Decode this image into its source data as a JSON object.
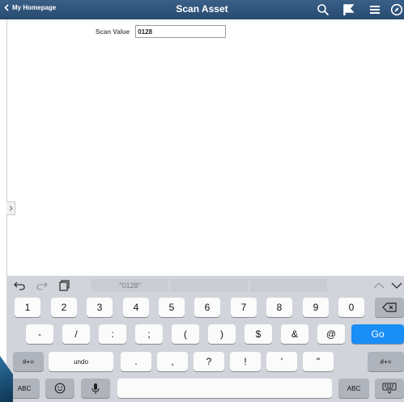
{
  "header": {
    "back_label": "My Homepage",
    "title": "Scan Asset",
    "icons": [
      "search-icon",
      "flag-icon",
      "menu-icon",
      "compass-icon"
    ]
  },
  "form": {
    "scan_label": "Scan Value",
    "scan_value": "0128"
  },
  "keyboard": {
    "toolbar_icons": [
      "undo-icon",
      "redo-icon",
      "paste-icon",
      "chevron-up-icon",
      "chevron-down-icon"
    ],
    "suggestions": [
      "\"0128\"",
      "",
      ""
    ],
    "row1": [
      "1",
      "2",
      "3",
      "4",
      "5",
      "6",
      "7",
      "8",
      "9",
      "0"
    ],
    "row2": [
      "-",
      "/",
      ":",
      ";",
      "(",
      ")",
      "$",
      "&",
      "@"
    ],
    "row2_go": "Go",
    "row3_mode_left": "#+=",
    "row3_undo": "undo",
    "row3": [
      ".",
      ",",
      "?",
      "!",
      "'",
      "\""
    ],
    "row3_mode_right": "#+=",
    "row4_abc_left": "ABC",
    "row4_abc_right": "ABC",
    "row4_icons": [
      "emoji-icon",
      "microphone-icon",
      "keyboard-dismiss-icon"
    ]
  },
  "colors": {
    "header_bg": "#2f5580",
    "go_key": "#1a8ef7",
    "keyboard_bg": "#d1d4da"
  }
}
